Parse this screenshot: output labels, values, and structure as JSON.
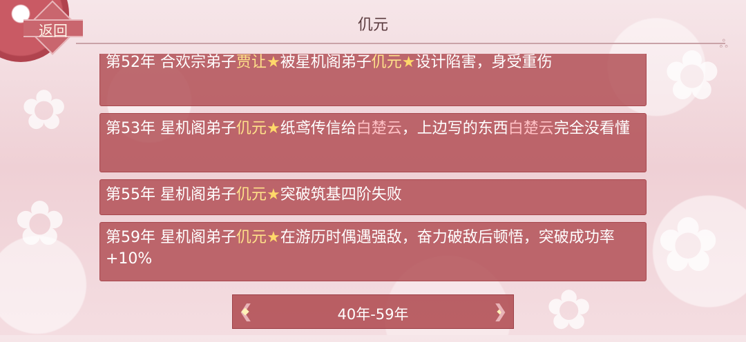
{
  "header": {
    "back_label": "返回",
    "title": "仉元"
  },
  "events": [
    {
      "parts": [
        {
          "t": "第52年 合欢宗弟子",
          "c": ""
        },
        {
          "t": "贾让",
          "c": "hl"
        },
        {
          "t": "★",
          "c": "star"
        },
        {
          "t": "被星机阁弟子",
          "c": ""
        },
        {
          "t": "仉元",
          "c": "hl"
        },
        {
          "t": "★",
          "c": "star"
        },
        {
          "t": "设计陷害，身受重伤",
          "c": ""
        }
      ]
    },
    {
      "parts": [
        {
          "t": "第53年 星机阁弟子",
          "c": ""
        },
        {
          "t": "仉元",
          "c": "hl"
        },
        {
          "t": "★",
          "c": "star"
        },
        {
          "t": "纸鸢传信给",
          "c": ""
        },
        {
          "t": "白楚云",
          "c": "pk"
        },
        {
          "t": "，上边写的东西",
          "c": ""
        },
        {
          "t": "白楚云",
          "c": "pk"
        },
        {
          "t": "完全没看懂",
          "c": ""
        }
      ]
    },
    {
      "parts": [
        {
          "t": "第55年 星机阁弟子",
          "c": ""
        },
        {
          "t": "仉元",
          "c": "hl"
        },
        {
          "t": "★",
          "c": "star"
        },
        {
          "t": "突破筑基四阶失败",
          "c": ""
        }
      ]
    },
    {
      "parts": [
        {
          "t": "第59年 星机阁弟子",
          "c": ""
        },
        {
          "t": "仉元",
          "c": "hl"
        },
        {
          "t": "★",
          "c": "star"
        },
        {
          "t": "在游历时偶遇强敌，奋力破敌后顿悟，突破成功率+10%",
          "c": ""
        }
      ]
    }
  ],
  "pager": {
    "label": "40年-59年"
  },
  "colors": {
    "panel": "#b04c52",
    "highlight": "#ffe28a",
    "pink_name": "#ffc0c4"
  }
}
